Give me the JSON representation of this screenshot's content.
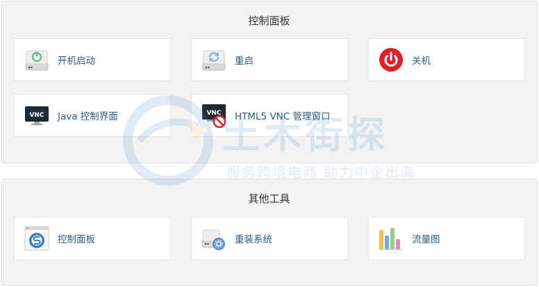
{
  "control_panel": {
    "title": "控制面板",
    "tiles": [
      {
        "label": "开机启动",
        "icon": "power-on-icon"
      },
      {
        "label": "重启",
        "icon": "restart-icon"
      },
      {
        "label": "关机",
        "icon": "shutdown-icon"
      },
      {
        "label": "Java 控制界面",
        "icon": "vnc-monitor-icon"
      },
      {
        "label": "HTML5 VNC 管理窗口",
        "icon": "vnc-disabled-icon"
      }
    ]
  },
  "other_tools": {
    "title": "其他工具",
    "tiles": [
      {
        "label": "控制面板",
        "icon": "control-panel-app-icon"
      },
      {
        "label": "重装系统",
        "icon": "reinstall-system-icon"
      },
      {
        "label": "流量图",
        "icon": "traffic-chart-icon"
      }
    ]
  },
  "colors": {
    "panel_bg": "#f3f3f3",
    "tile_label": "#2c5d84",
    "shutdown_red": "#e02026",
    "power_green": "#5cc07a"
  },
  "watermark": {
    "main": "土木街探",
    "sub": "服务跨境电商 助力中企出海"
  }
}
